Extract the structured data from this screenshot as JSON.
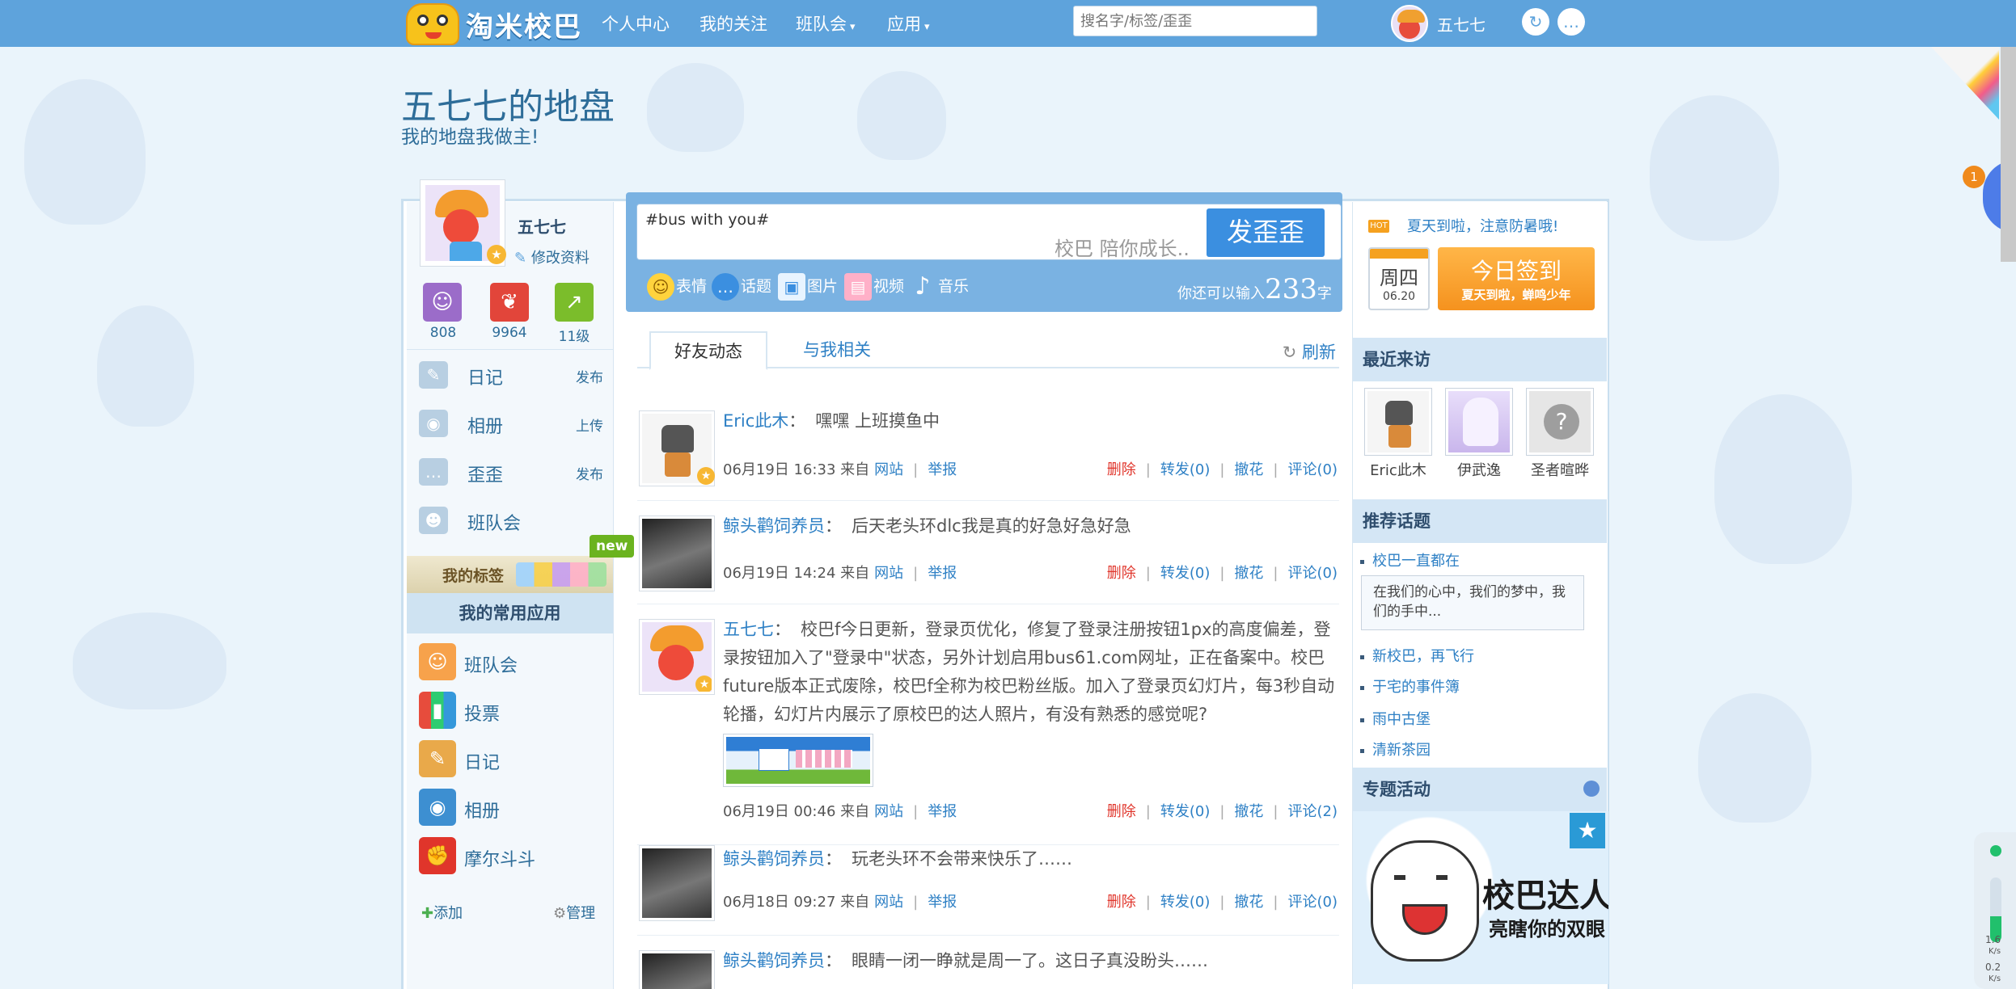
{
  "topbar": {
    "logo_text": "淘米校巴",
    "nav": [
      "个人中心",
      "我的关注",
      "班队会",
      "应用"
    ],
    "search_placeholder": "搜名字/标签/歪歪",
    "username": "五七七",
    "icons": [
      "refresh-icon",
      "chat-icon"
    ]
  },
  "header": {
    "title": "五七七的地盘",
    "subtitle": "我的地盘我做主!"
  },
  "profile": {
    "name": "五七七",
    "edit_label": "修改资料",
    "stats": [
      {
        "value": "808",
        "icon": "user-icon"
      },
      {
        "value": "9964",
        "icon": "bean-icon"
      },
      {
        "value": "11级",
        "icon": "chart-icon"
      }
    ]
  },
  "left_menu": [
    {
      "label": "日记",
      "action": "发布",
      "icon": "pen-icon"
    },
    {
      "label": "相册",
      "action": "上传",
      "icon": "camera-icon"
    },
    {
      "label": "歪歪",
      "action": "发布",
      "icon": "speech-icon"
    },
    {
      "label": "班队会",
      "action": "",
      "icon": "people-icon"
    }
  ],
  "tags_banner": {
    "label": "我的标签",
    "badge": "new"
  },
  "apps": {
    "heading": "我的常用应用",
    "items": [
      "班队会",
      "投票",
      "日记",
      "相册",
      "摩尔斗斗"
    ],
    "add_label": "添加",
    "manage_label": "管理"
  },
  "composer": {
    "value": "#bus with you#",
    "watermark": "校巴 陪你成长..",
    "post_label": "发歪歪",
    "tools": [
      "表情",
      "话题",
      "图片",
      "视频",
      "音乐"
    ],
    "remaining_prefix": "你还可以输入",
    "remaining": "233",
    "remaining_suffix": "字"
  },
  "tabs": {
    "items": [
      "好友动态",
      "与我相关"
    ],
    "refresh_label": "刷新"
  },
  "feed": [
    {
      "name": "Eric此木",
      "text": "嘿嘿 上班摸鱼中",
      "time": "06月19日 16:33",
      "from": "来自",
      "source": "网站",
      "report": "举报",
      "delete": "删除",
      "forward": "转发(0)",
      "retract": "撤花",
      "comment": "评论(0)"
    },
    {
      "name": "鲸头鹳饲养员",
      "text": "后天老头环dlc我是真的好急好急好急",
      "time": "06月19日 14:24",
      "from": "来自",
      "source": "网站",
      "report": "举报",
      "delete": "删除",
      "forward": "转发(0)",
      "retract": "撤花",
      "comment": "评论(0)"
    },
    {
      "name": "五七七",
      "text": "校巴f今日更新，登录页优化，修复了登录注册按钮1px的高度偏差，登录按钮加入了\"登录中\"状态，另外计划启用bus61.com网址，正在备案中。校巴future版本正式废除，校巴f全称为校巴粉丝版。加入了登录页幻灯片，每3秒自动轮播，幻灯片内展示了原校巴的达人照片，有没有熟悉的感觉呢?",
      "time": "06月19日 00:46",
      "from": "来自",
      "source": "网站",
      "report": "举报",
      "delete": "删除",
      "forward": "转发(0)",
      "retract": "撤花",
      "comment": "评论(2)"
    },
    {
      "name": "鲸头鹳饲养员",
      "text": "玩老头环不会带来快乐了……",
      "time": "06月18日 09:27",
      "from": "来自",
      "source": "网站",
      "report": "举报",
      "delete": "删除",
      "forward": "转发(0)",
      "retract": "撤花",
      "comment": "评论(0)"
    },
    {
      "name": "鲸头鹳饲养员",
      "text": "眼睛一闭一睁就是周一了。这日子真没盼头……"
    }
  ],
  "right": {
    "hot_badge": "HOT",
    "notice": "夏天到啦，注意防暑哦!",
    "calendar": {
      "weekday": "周四",
      "date": "06.20"
    },
    "checkin": {
      "label": "今日签到",
      "sub": "夏天到啦，蝉鸣少年"
    },
    "visitors_heading": "最近来访",
    "visitors": [
      "Eric此木",
      "伊武逸",
      "圣者暄晔"
    ],
    "topics_heading": "推荐话题",
    "topics": [
      "校巴一直都在",
      "新校巴，再飞行",
      "于宅的事件簿",
      "雨中古堡",
      "清新茶园"
    ],
    "topic_quote": "在我们的心中，我们的梦中，我们的手中...",
    "activity_heading": "专题活动",
    "activity_banner": {
      "title": "校巴达人",
      "sub": "亮瞎你的双眼"
    }
  },
  "side_widget": {
    "badge": "1",
    "speeds": [
      "1.6",
      "K/s",
      "0.2",
      "K/s"
    ]
  },
  "colors": {
    "topbar": "#5ea3dc",
    "link": "#2e80c5",
    "accent_orange": "#f5a11f",
    "delete_red": "#e0352b"
  }
}
